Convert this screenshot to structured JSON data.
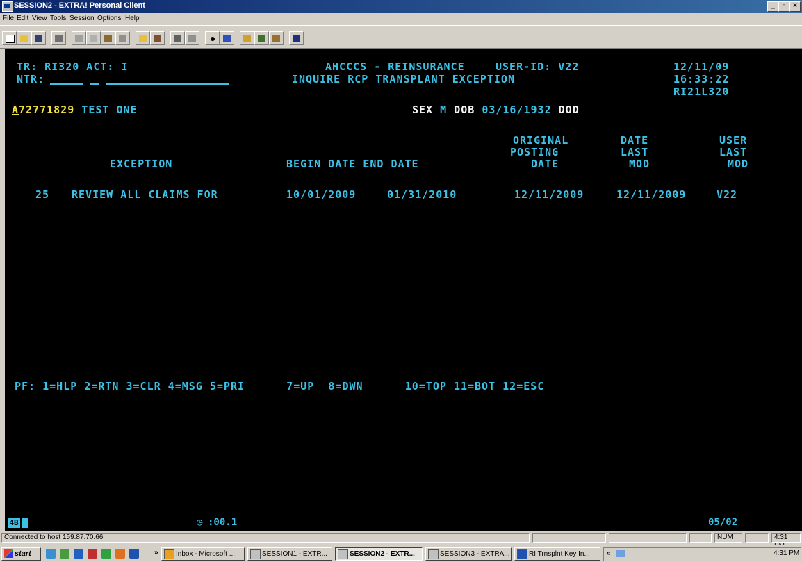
{
  "window": {
    "title": "SESSION2 - EXTRA! Personal Client"
  },
  "menu": [
    "File",
    "Edit",
    "View",
    "Tools",
    "Session",
    "Options",
    "Help"
  ],
  "toolbar_icons": [
    "new-icon",
    "open-icon",
    "save-icon",
    "print-icon",
    "cut-icon",
    "copy-icon",
    "paste-icon",
    "macro-icon",
    "folder-icon",
    "tools-icon",
    "transfer-icon",
    "dial-icon",
    "record-icon",
    "hotspot-icon",
    "quickpad-icon",
    "keyboard-icon",
    "settings-icon",
    "help-icon"
  ],
  "screen": {
    "tr": "TR: RI320 ACT: I",
    "ntr": "NTR:",
    "system": "AHCCCS - REINSURANCE",
    "user_id": "USER-ID: V22",
    "date": "12/11/09",
    "screen_title": "INQUIRE RCP TRANSPLANT EXCEPTION",
    "time": "16:33:22",
    "screen_id": "RI21L320",
    "member_prefix": "A",
    "member_id": "72771829",
    "member_name": "TEST ONE",
    "sex_label": "SEX",
    "sex": "M",
    "dob_label": "DOB",
    "dob": "03/16/1932",
    "dod_label": "DOD",
    "headers": {
      "original": "ORIGINAL",
      "posting": "POSTING",
      "date_col": "DATE",
      "date": "DATE",
      "last": "LAST",
      "mod": "MOD",
      "user": "USER",
      "user_last": "LAST",
      "user_mod": "MOD",
      "exception": "EXCEPTION",
      "begin_end": "BEGIN DATE END DATE"
    },
    "row": {
      "code": "25",
      "exception": "REVIEW ALL CLAIMS FOR",
      "begin": "10/01/2009",
      "end": "01/31/2010",
      "posting": "12/11/2009",
      "last_mod": "12/11/2009",
      "user": "V22"
    },
    "pf_keys": "PF: 1=HLP 2=RTN 3=CLR 4=MSG 5=PRI      7=UP  8=DWN      10=TOP 11=BOT 12=ESC"
  },
  "terminal_status": {
    "mode": "4B",
    "timer": ":00.1",
    "cursor": "05/02"
  },
  "status_bar": {
    "connection": "Connected to host 159.87.70.66",
    "num": "NUM",
    "time": "4:31 PM"
  },
  "taskbar": {
    "start": "start",
    "buttons": [
      "Inbox - Microsoft ...",
      "SESSION1 - EXTR...",
      "SESSION2 - EXTR...",
      "SESSION3 - EXTRA...",
      "RI Trnsplnt Key In..."
    ],
    "clock": "4:31 PM"
  }
}
